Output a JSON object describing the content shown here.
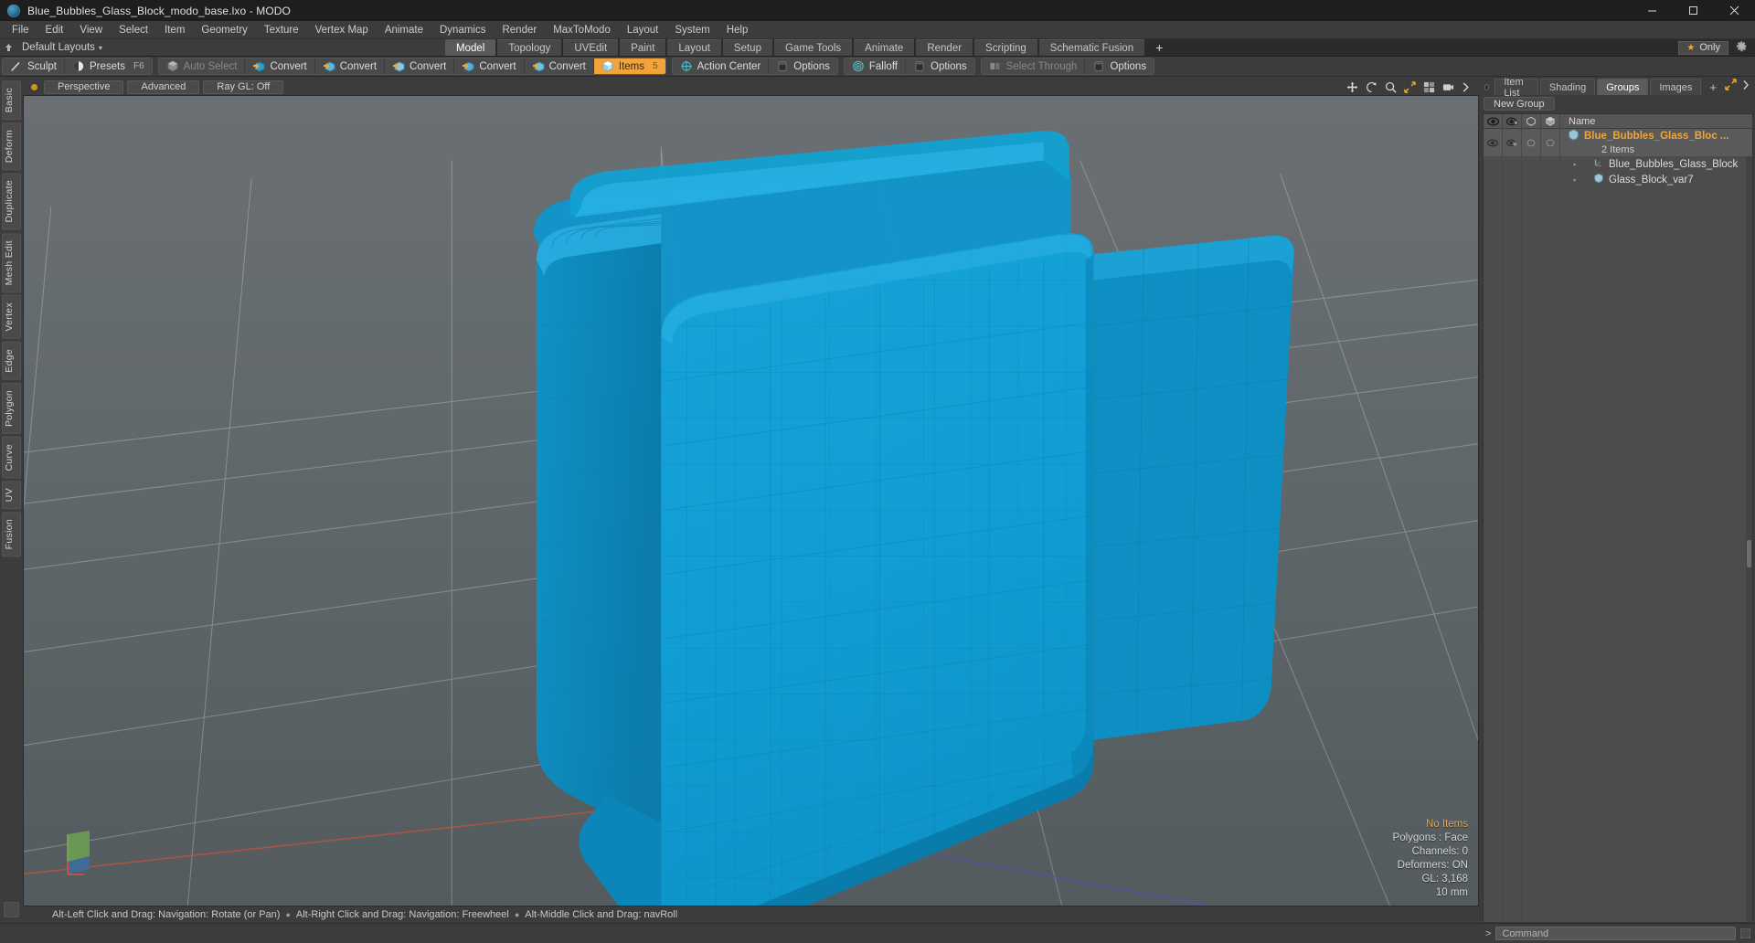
{
  "window": {
    "title": "Blue_Bubbles_Glass_Block_modo_base.lxo - MODO",
    "app_icon": "modo-sphere-icon",
    "minimize_label": "Minimize",
    "maximize_label": "Maximize",
    "close_label": "Close"
  },
  "menubar": {
    "items": [
      {
        "label": "File"
      },
      {
        "label": "Edit"
      },
      {
        "label": "View"
      },
      {
        "label": "Select"
      },
      {
        "label": "Item"
      },
      {
        "label": "Geometry"
      },
      {
        "label": "Texture"
      },
      {
        "label": "Vertex Map"
      },
      {
        "label": "Animate"
      },
      {
        "label": "Dynamics"
      },
      {
        "label": "Render"
      },
      {
        "label": "MaxToModo"
      },
      {
        "label": "Layout"
      },
      {
        "label": "System"
      },
      {
        "label": "Help"
      }
    ]
  },
  "layoutbar": {
    "default_layouts_label": "Default Layouts",
    "caret": "▾",
    "tabs": [
      {
        "label": "Model",
        "active": true
      },
      {
        "label": "Topology",
        "active": false
      },
      {
        "label": "UVEdit",
        "active": false
      },
      {
        "label": "Paint",
        "active": false
      },
      {
        "label": "Layout",
        "active": false
      },
      {
        "label": "Setup",
        "active": false
      },
      {
        "label": "Game Tools",
        "active": false
      },
      {
        "label": "Animate",
        "active": false
      },
      {
        "label": "Render",
        "active": false
      },
      {
        "label": "Scripting",
        "active": false
      },
      {
        "label": "Schematic Fusion",
        "active": false
      }
    ],
    "add_tab_label": "+",
    "only_label": "Only",
    "only_star": "★",
    "gear_icon": "gear-icon"
  },
  "toolbar": {
    "groups": [
      {
        "buttons": [
          {
            "label": "Sculpt",
            "icon": "sculpt-brush-icon",
            "shortcut": "",
            "state": "normal"
          },
          {
            "label": "Presets",
            "icon": "presets-sphere-icon",
            "shortcut": "F6",
            "state": "normal"
          }
        ]
      },
      {
        "buttons": [
          {
            "label": "Auto Select",
            "icon": "cube-gray-icon",
            "shortcut": "",
            "state": "disabled"
          },
          {
            "label": "Convert",
            "icon": "convert-vertex-icon",
            "shortcut": "",
            "state": "normal"
          },
          {
            "label": "Convert",
            "icon": "convert-edge-icon",
            "shortcut": "",
            "state": "normal"
          },
          {
            "label": "Convert",
            "icon": "convert-polygon-icon",
            "shortcut": "",
            "state": "normal"
          },
          {
            "label": "Convert",
            "icon": "convert-material-icon",
            "shortcut": "",
            "state": "normal"
          },
          {
            "label": "Convert",
            "icon": "convert-item-icon",
            "shortcut": "",
            "state": "normal"
          },
          {
            "label": "Items",
            "icon": "items-cube-icon",
            "shortcut": "5",
            "state": "active"
          }
        ]
      },
      {
        "buttons": [
          {
            "label": "Action Center",
            "icon": "action-center-icon",
            "shortcut": "",
            "state": "normal"
          },
          {
            "label": "Options",
            "icon": "options-panel-icon",
            "shortcut": "",
            "state": "normal"
          }
        ]
      },
      {
        "buttons": [
          {
            "label": "Falloff",
            "icon": "falloff-icon",
            "shortcut": "",
            "state": "normal"
          },
          {
            "label": "Options",
            "icon": "options-panel-icon",
            "shortcut": "",
            "state": "normal"
          }
        ]
      },
      {
        "buttons": [
          {
            "label": "Select Through",
            "icon": "select-through-icon",
            "shortcut": "",
            "state": "disabled"
          },
          {
            "label": "Options",
            "icon": "options-panel-icon",
            "shortcut": "",
            "state": "normal"
          }
        ]
      }
    ]
  },
  "left_rail": {
    "tabs": [
      {
        "label": "Basic"
      },
      {
        "label": "Deform"
      },
      {
        "label": "Duplicate"
      },
      {
        "label": "Mesh Edit"
      },
      {
        "label": "Vertex"
      },
      {
        "label": "Edge"
      },
      {
        "label": "Polygon"
      },
      {
        "label": "Curve"
      },
      {
        "label": "UV"
      },
      {
        "label": "Fusion"
      }
    ]
  },
  "viewport": {
    "view_mode": "Perspective",
    "shading_mode": "Advanced",
    "raygl": "Ray GL: Off",
    "header_icons": [
      "move-icon",
      "rotate-icon",
      "zoom-icon",
      "fit-icon",
      "grid-icon",
      "camera-icon",
      "chevron-right-icon"
    ],
    "stats": {
      "selection": "No Items",
      "polygons": "Polygons : Face",
      "channels": "Channels: 0",
      "deformers": "Deformers: ON",
      "gl": "GL: 3,168",
      "grid": "10 mm"
    },
    "status_hints": [
      "Alt-Left Click and Drag: Navigation: Rotate (or Pan)",
      "Alt-Right Click and Drag: Navigation: Freewheel",
      "Alt-Middle Click and Drag: navRoll"
    ],
    "model_color": "#109ed4",
    "model_color_dark": "#0b7fae",
    "model_color_light": "#2bb4e6",
    "gizmo_axes": [
      "x-axis-red",
      "y-axis-green",
      "z-axis-blue"
    ]
  },
  "right_panel": {
    "tabs": [
      {
        "label": "Item List",
        "active": false
      },
      {
        "label": "Shading",
        "active": false
      },
      {
        "label": "Groups",
        "active": true
      },
      {
        "label": "Images",
        "active": false
      }
    ],
    "add_tab_label": "+",
    "expand_icon": "expand-arrows-icon",
    "more_icon": "chevron-right-icon",
    "new_group_label": "New Group",
    "columns": [
      {
        "icon": "eye-icon",
        "name": "visibility"
      },
      {
        "icon": "render-eye-icon",
        "name": "render-visibility"
      },
      {
        "icon": "cube-outline-icon",
        "name": "lock"
      },
      {
        "icon": "cube-solid-icon",
        "name": "select"
      }
    ],
    "name_column_header": "Name",
    "tree": {
      "group": {
        "icon": "group-shield-icon",
        "label": "Blue_Bubbles_Glass_Bloc ...",
        "count_label": "2 Items",
        "selected": true
      },
      "children": [
        {
          "icon": "locator-axis-icon",
          "label": "Blue_Bubbles_Glass_Block"
        },
        {
          "icon": "mesh-shield-icon",
          "label": "Glass_Block_var7"
        }
      ]
    }
  },
  "command_bar": {
    "prompt": "&gt;",
    "placeholder": "Command",
    "value": ""
  },
  "colors": {
    "accent_orange": "#f2a33c",
    "group_text": "#f0a63a",
    "panel_bg": "#3c3c3c",
    "viewport_bg": "#63696d",
    "model_blue": "#109ed4"
  }
}
